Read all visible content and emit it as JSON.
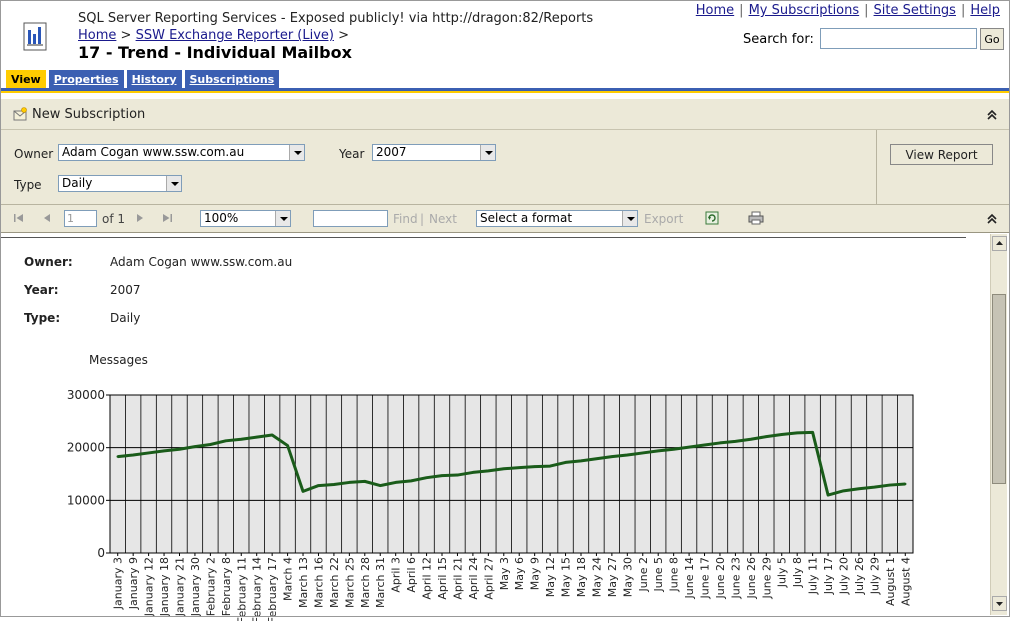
{
  "header": {
    "server_line": "SQL Server Reporting Services - Exposed publicly! via http://dragon:82/Reports",
    "breadcrumb": {
      "home": "Home",
      "sep1": ">",
      "folder": "SSW Exchange Reporter (Live)",
      "sep2": ">"
    },
    "page_title": "17 - Trend - Individual Mailbox",
    "top_links": [
      "Home",
      "My Subscriptions",
      "Site Settings",
      "Help"
    ],
    "search_label": "Search for:",
    "search_value": "",
    "go_label": "Go"
  },
  "tabs": [
    {
      "label": "View",
      "active": true
    },
    {
      "label": "Properties",
      "active": false
    },
    {
      "label": "History",
      "active": false
    },
    {
      "label": "Subscriptions",
      "active": false
    }
  ],
  "subscription_bar": {
    "new_subscription_label": "New Subscription"
  },
  "parameters": {
    "owner_label": "Owner",
    "owner_value": "Adam Cogan www.ssw.com.au",
    "year_label": "Year",
    "year_value": "2007",
    "type_label": "Type",
    "type_value": "Daily",
    "view_report_label": "View Report"
  },
  "toolbar": {
    "page_value": "1",
    "of_pages": "of 1",
    "zoom": "100%",
    "find_value": "",
    "find_label": "Find",
    "sep": "|",
    "next_label": "Next",
    "format_placeholder": "Select a format",
    "export_label": "Export"
  },
  "report": {
    "owner_label": "Owner:",
    "owner_value": "Adam Cogan www.ssw.com.au",
    "year_label": "Year:",
    "year_value": "2007",
    "type_label": "Type:",
    "type_value": "Daily"
  },
  "colors": {
    "tab_blue": "#3b5fb2",
    "tab_active": "#ffcc00",
    "toolbar_bg": "#ece9d8",
    "line": "#1a5c1a",
    "plot_bg": "#e6e6e6"
  },
  "chart_data": {
    "type": "line",
    "ylabel": "Messages",
    "xlabel": "",
    "ylim": [
      0,
      30000
    ],
    "yticks": [
      0,
      10000,
      20000,
      30000
    ],
    "grid": true,
    "categories": [
      "January 3",
      "January 9",
      "January 12",
      "January 18",
      "January 21",
      "January 30",
      "February 2",
      "February 8",
      "February 11",
      "February 14",
      "February 17",
      "March 4",
      "March 13",
      "March 16",
      "March 22",
      "March 25",
      "March 28",
      "March 31",
      "April 3",
      "April 6",
      "April 12",
      "April 15",
      "April 21",
      "April 24",
      "April 27",
      "May 3",
      "May 6",
      "May 9",
      "May 12",
      "May 15",
      "May 18",
      "May 24",
      "May 27",
      "May 30",
      "June 2",
      "June 5",
      "June 8",
      "June 14",
      "June 17",
      "June 20",
      "June 23",
      "June 26",
      "June 29",
      "July 5",
      "July 8",
      "July 11",
      "July 17",
      "July 20",
      "July 26",
      "July 29",
      "August 1",
      "August 4"
    ],
    "values": [
      18300,
      18600,
      19000,
      19400,
      19700,
      20200,
      20600,
      21300,
      21600,
      22000,
      22400,
      20400,
      11700,
      12800,
      13000,
      13400,
      13600,
      12800,
      13400,
      13700,
      14300,
      14700,
      14800,
      15300,
      15600,
      16000,
      16200,
      16400,
      16500,
      17200,
      17500,
      17900,
      18300,
      18600,
      19000,
      19400,
      19700,
      20100,
      20500,
      20900,
      21200,
      21600,
      22100,
      22500,
      22800,
      22900,
      11000,
      11800,
      12200,
      12500,
      12900,
      13100
    ]
  }
}
